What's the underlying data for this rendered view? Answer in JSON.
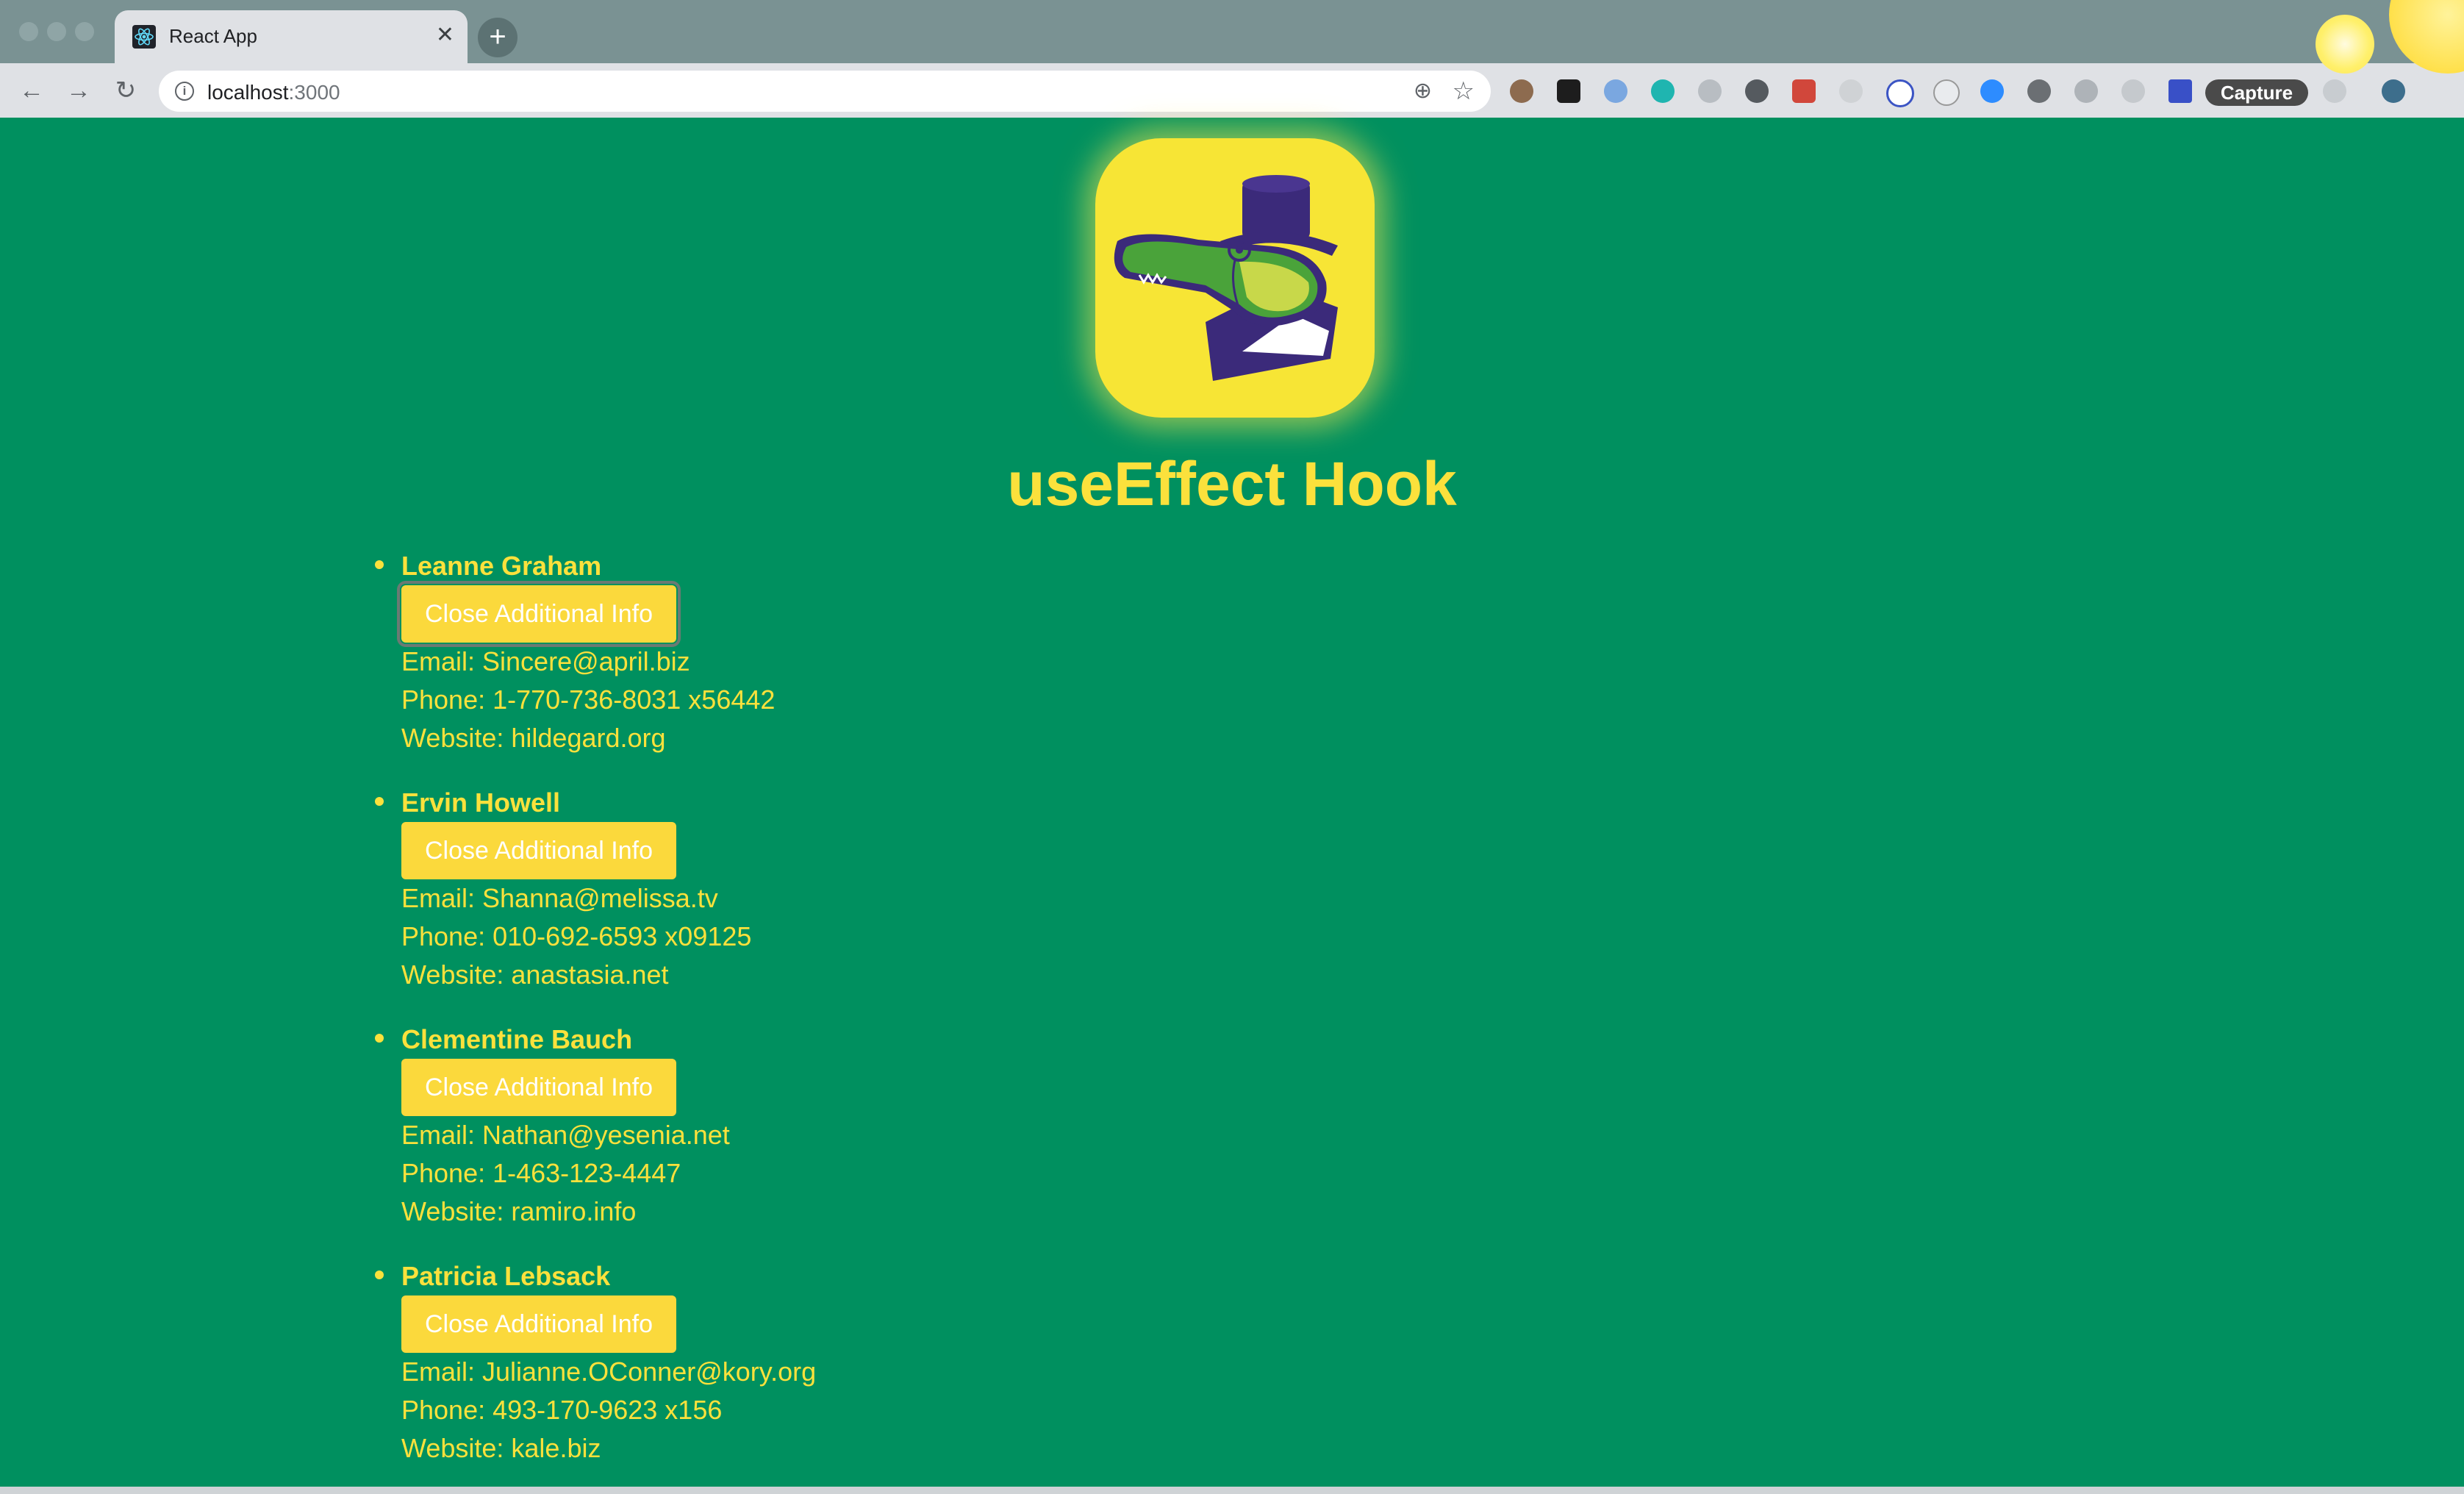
{
  "browser": {
    "tab_title": "React App",
    "url_host": "localhost",
    "url_port": ":3000",
    "capture_label": "Capture"
  },
  "page": {
    "title": "useEffect Hook",
    "users": [
      {
        "name": "Leanne Graham",
        "button": "Close Additional Info",
        "email": "Email: Sincere@april.biz",
        "phone": "Phone: 1-770-736-8031 x56442",
        "website": "Website: hildegard.org"
      },
      {
        "name": "Ervin Howell",
        "button": "Close Additional Info",
        "email": "Email: Shanna@melissa.tv",
        "phone": "Phone: 010-692-6593 x09125",
        "website": "Website: anastasia.net"
      },
      {
        "name": "Clementine Bauch",
        "button": "Close Additional Info",
        "email": "Email: Nathan@yesenia.net",
        "phone": "Phone: 1-463-123-4447",
        "website": "Website: ramiro.info"
      },
      {
        "name": "Patricia Lebsack",
        "button": "Close Additional Info",
        "email": "Email: Julianne.OConner@kory.org",
        "phone": "Phone: 493-170-9623 x156",
        "website": "Website: kale.biz"
      }
    ]
  },
  "colors": {
    "background": "#00905f",
    "accent_yellow": "#fbe13c",
    "button_yellow": "#fbd93c"
  },
  "icons": [
    "react-icon",
    "close-icon",
    "plus-icon",
    "back-arrow-icon",
    "forward-arrow-icon",
    "reload-icon",
    "info-icon",
    "zoom-icon",
    "star-icon",
    "gator-logo-icon"
  ]
}
